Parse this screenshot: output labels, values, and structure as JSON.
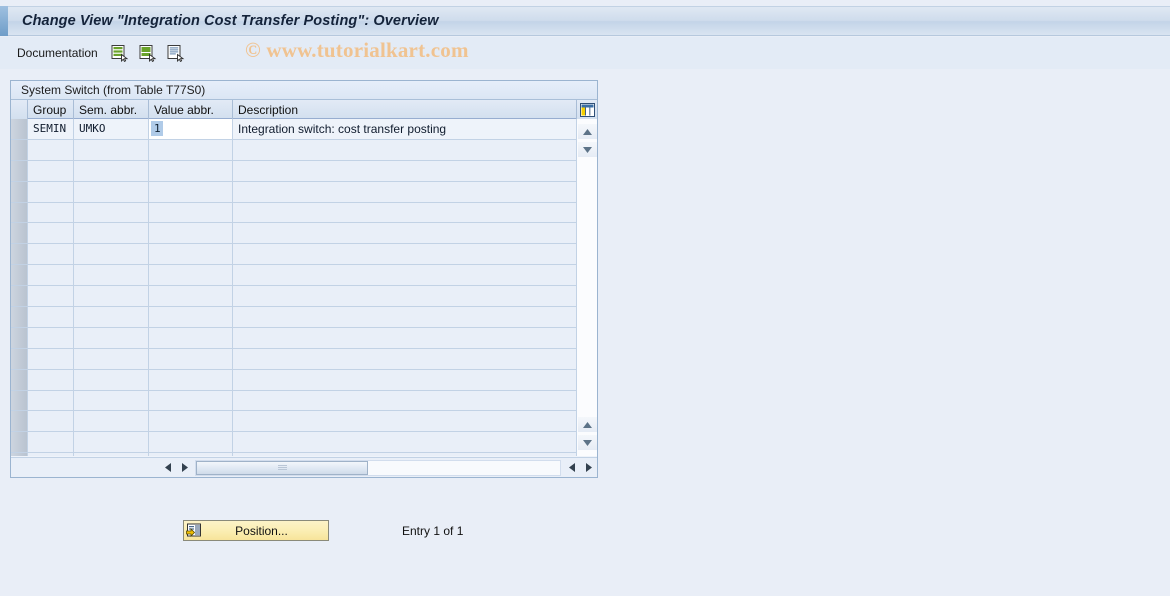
{
  "window": {
    "title": "Change View \"Integration Cost Transfer Posting\": Overview"
  },
  "toolbar": {
    "documentation_label": "Documentation",
    "icons": [
      {
        "name": "documentation-list-icon",
        "title": "Documentation"
      },
      {
        "name": "documentation-page-icon",
        "title": "Display Documentation"
      },
      {
        "name": "documentation-text-icon",
        "title": "Text Documentation"
      }
    ]
  },
  "watermark": {
    "text": "© www.tutorialkart.com",
    "color": "#f0c391"
  },
  "panel": {
    "heading": "System Switch (from Table T77S0)",
    "columns": [
      {
        "key": "selector",
        "label": ""
      },
      {
        "key": "group",
        "label": "Group"
      },
      {
        "key": "sem",
        "label": "Sem. abbr."
      },
      {
        "key": "value",
        "label": "Value abbr."
      },
      {
        "key": "description",
        "label": "Description"
      }
    ],
    "config_icon": "table-settings-icon",
    "rows": [
      {
        "group": "SEMIN",
        "sem": "UMKO",
        "value": "1",
        "value_selected": true,
        "description": "Integration switch: cost transfer posting"
      }
    ],
    "empty_row_count": 16
  },
  "scrollbars": {
    "vertical_up_icon": "scroll-up-icon",
    "vertical_down_icon": "scroll-down-icon",
    "horizontal_left_icon": "scroll-left-icon",
    "horizontal_right_icon": "scroll-right-icon"
  },
  "footer": {
    "position_button_label": "Position...",
    "position_button_icon": "position-row-icon",
    "entry_status": "Entry 1 of 1"
  },
  "colors": {
    "page_background": "#e9eef7",
    "title_accent": "#6f9dc8",
    "button_yellow": "#fbeeb4",
    "selection_blue": "#b0cbe8",
    "grid_line": "#c2d2e5"
  }
}
